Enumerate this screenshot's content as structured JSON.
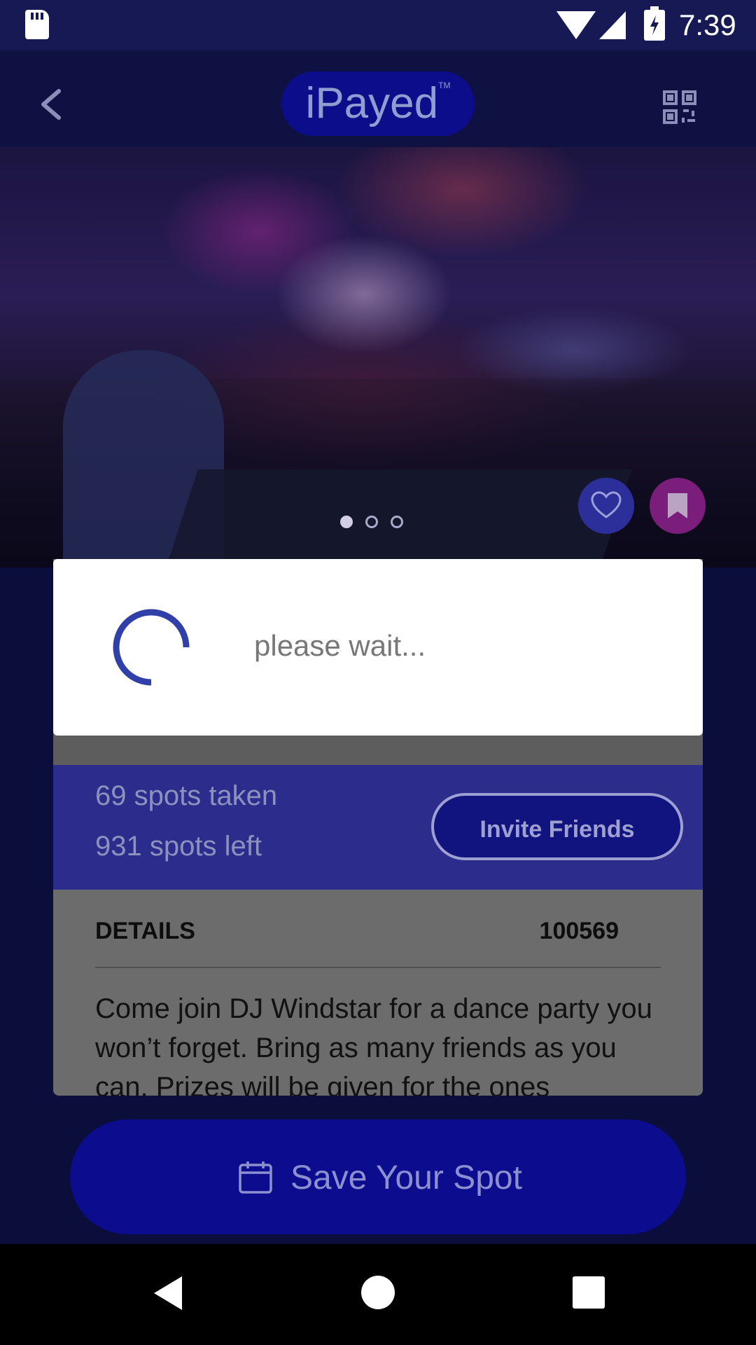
{
  "status_bar": {
    "time": "7:39",
    "icons": [
      "sd-card-icon",
      "wifi-icon",
      "signal-icon",
      "battery-charging-icon"
    ]
  },
  "app_bar": {
    "logo_text": "iPayed",
    "logo_tm": "TM",
    "left_icon": "back-arrow-icon",
    "right_icon": "qr-code-icon"
  },
  "carousel": {
    "page_count": 3,
    "active_index": 0
  },
  "hero_actions": {
    "heart_icon": "heart-icon",
    "bookmark_icon": "bookmark-icon"
  },
  "event": {
    "spots_taken": "69 spots taken",
    "spots_left": "931 spots left",
    "invite_label": "Invite Friends",
    "details_label": "DETAILS",
    "details_id": "100569",
    "description": "Come join DJ Windstar for a dance party you won’t forget. Bring as many friends as you can. Prizes will be given for the ones"
  },
  "save_button": {
    "label": "Save Your Spot",
    "icon": "calendar-icon"
  },
  "dialog": {
    "message": "please wait...",
    "icon": "loading-spinner"
  },
  "nav_bar": {
    "icons": [
      "back-triangle-icon",
      "home-circle-icon",
      "recents-square-icon"
    ]
  },
  "colors": {
    "brand": "#0c0c8e",
    "accent": "#2c2c8c",
    "dialog_bg": "#ffffff",
    "spinner": "#3140a8"
  }
}
